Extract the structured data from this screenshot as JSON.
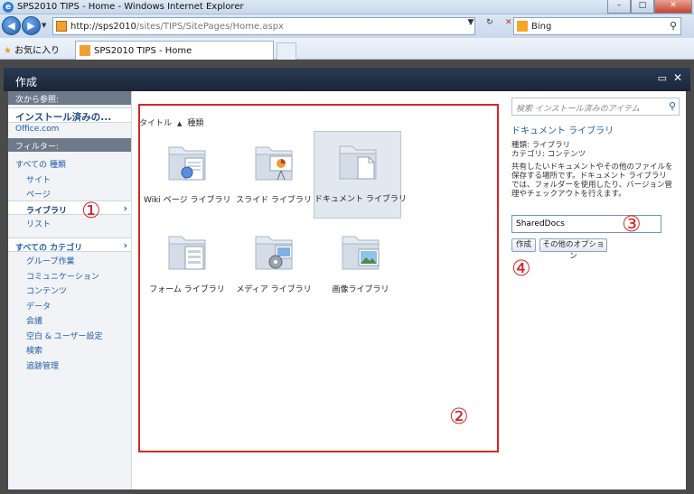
{
  "window": {
    "title": "SPS2010 TIPS - Home - Windows Internet Explorer",
    "min_icon": "minimize-icon",
    "max_icon": "maximize-icon",
    "close_icon": "close-icon"
  },
  "address": {
    "url_host": "http://sps2010",
    "url_path": "/sites/TIPS/SitePages/Home.aspx",
    "search_provider": "Bing"
  },
  "favorites": {
    "label": "お気に入り",
    "tab_title": "SPS2010 TIPS - Home"
  },
  "dialog": {
    "title": "作成"
  },
  "leftnav": {
    "browse_header": "次から参照:",
    "installed_label": "インストール済みの...",
    "office_link": "Office.com",
    "filter_header": "フィルター:",
    "all_types": "すべての 種類",
    "types": [
      "サイト",
      "ページ",
      "ライブラリ",
      "リスト"
    ],
    "all_categories": "すべての カテゴリ",
    "categories": [
      "グループ作業",
      "コミュニケーション",
      "コンテンツ",
      "データ",
      "会議",
      "空白 & ユーザー設定",
      "検索",
      "追跡管理"
    ]
  },
  "middle": {
    "sort_title": "タイトル",
    "sort_type": "種類",
    "tiles": [
      {
        "label": "Wiki ページ ライブラリ"
      },
      {
        "label": "スライド ライブラリ"
      },
      {
        "label": "ドキュメント ライブラリ"
      },
      {
        "label": "フォーム ライブラリ"
      },
      {
        "label": "メディア ライブラリ"
      },
      {
        "label": "画像ライブラリ"
      }
    ]
  },
  "right": {
    "search_placeholder": "検索 インストール済みのアイテム",
    "item_title": "ドキュメント ライブラリ",
    "type_line": "種類: ライブラリ",
    "category_line": "カテゴリ: コンテンツ",
    "description": "共有したいドキュメントやその他のファイルを保存する場所です。ドキュメント ライブラリでは、フォルダーを使用したり、バージョン管理やチェックアウトを行えます。",
    "name_value": "SharedDocs",
    "create_button": "作成",
    "more_button": "その他のオプション"
  },
  "callouts": [
    "①",
    "②",
    "③",
    "④"
  ]
}
